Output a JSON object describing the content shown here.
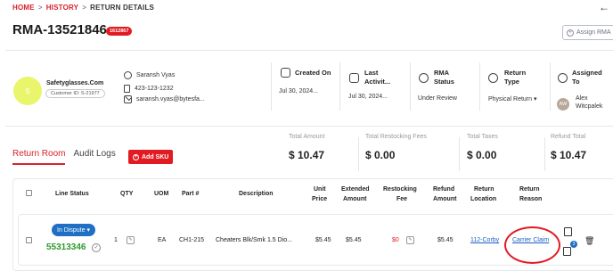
{
  "breadcrumb": {
    "home": "HOME",
    "history": "HISTORY",
    "current": "RETURN DETAILS",
    "sep": ">"
  },
  "header": {
    "title": "RMA-13521846",
    "badge": "1612867",
    "assign_label": "Assign RMA"
  },
  "customer": {
    "avatar_initial": "S",
    "company": "Safetyglasses.Com",
    "customer_id": "Customer ID: S-21977",
    "contact_name": "Saransh Vyas",
    "phone": "423-123-1232",
    "email": "saransh.vyas@bytesfa..."
  },
  "columns": {
    "created_on": {
      "label": "Created On",
      "value": "Jul 30, 2024..."
    },
    "last_activity": {
      "label_1": "Last",
      "label_2": "Activit...",
      "value": "Jul 30, 2024..."
    },
    "rma_status": {
      "label_1": "RMA",
      "label_2": "Status",
      "value": "Under Review"
    },
    "return_type": {
      "label_1": "Return",
      "label_2": "Type",
      "value": "Physical Return ▾"
    },
    "assigned_to": {
      "label_1": "Assigned",
      "label_2": "To",
      "initials": "AW",
      "name_1": "Alex",
      "name_2": "Witcpalek"
    }
  },
  "tabs": {
    "return_room": "Return Room",
    "audit_logs": "Audit Logs",
    "add_sku": "Add SKU"
  },
  "totals": [
    {
      "label": "Total Amount",
      "value": "$ 10.47"
    },
    {
      "label": "Total Restocking Fees",
      "value": "$ 0.00"
    },
    {
      "label": "Total Taxes",
      "value": "$ 0.00"
    },
    {
      "label": "Refund Total",
      "value": "$ 10.47"
    }
  ],
  "table": {
    "headers": {
      "line_status": "Line Status",
      "qty": "QTY",
      "uom": "UOM",
      "part": "Part #",
      "description": "Description",
      "unit_price_1": "Unit",
      "unit_price_2": "Price",
      "ext_amount_1": "Extended",
      "ext_amount_2": "Amount",
      "restock_1": "Restocking",
      "restock_2": "Fee",
      "refund_1": "Refund",
      "refund_2": "Amount",
      "ret_loc_1": "Return",
      "ret_loc_2": "Location",
      "ret_reason_1": "Return",
      "ret_reason_2": "Reason"
    },
    "row": {
      "status": "In Dispute ▾",
      "order_no": "55313346",
      "qty": "1",
      "uom": "EA",
      "part": "CH1-215",
      "description": "Cheaters Blk/Smk 1.5 Dio...",
      "unit_price": "$5.45",
      "ext_amount": "$5.45",
      "restock_fee": "$0",
      "refund_amount": "$5.45",
      "return_location": "112-Corby",
      "return_reason": "Carrier Claim",
      "notes_count": "3"
    }
  },
  "colors": {
    "brand_red": "#e21b23",
    "status_blue": "#1f6fc4",
    "order_green": "#2e9b2e"
  }
}
